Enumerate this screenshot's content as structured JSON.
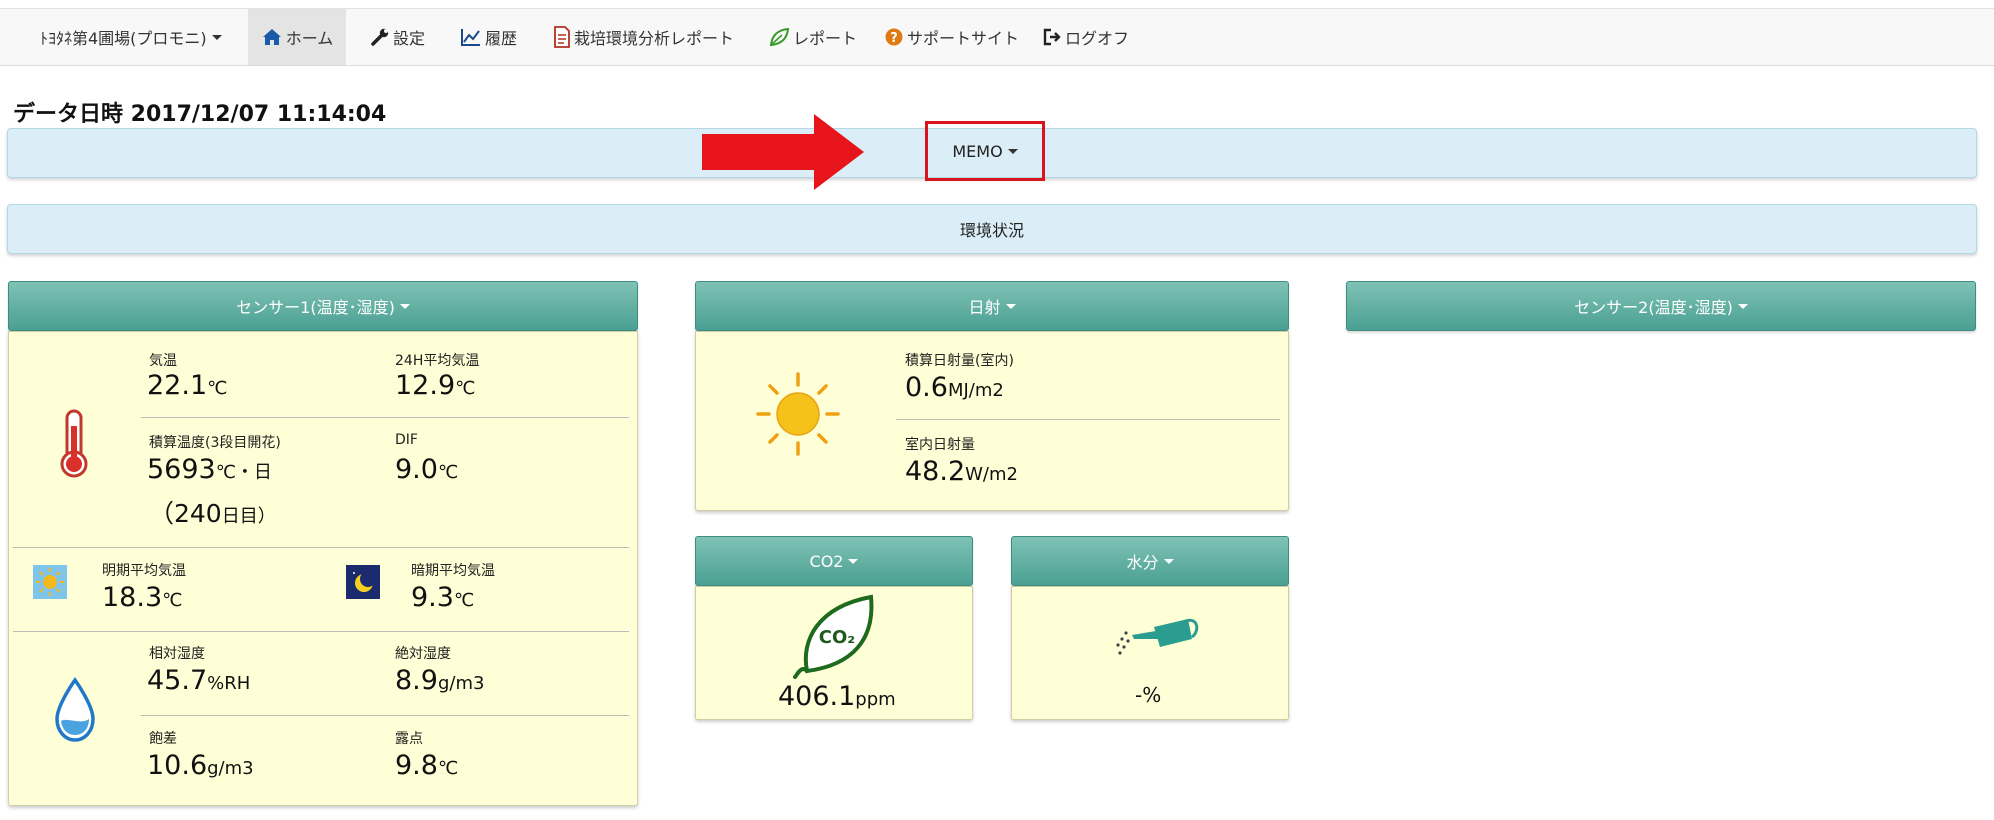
{
  "nav": {
    "farm": "ﾄﾖﾀﾈ第4圃場(プロモニ)",
    "home": "ホーム",
    "settings": "設定",
    "history": "履歴",
    "analysis_report": "栽培環境分析レポート",
    "report": "レポート",
    "support": "サポートサイト",
    "logoff": "ログオフ"
  },
  "data_time": "データ日時 2017/12/07 11:14:04",
  "memo_label": "MEMO",
  "env_status_label": "環境状況",
  "sensor1": {
    "title": "センサー1(温度･湿度)",
    "temp_label": "気温",
    "temp_value": "22.1",
    "temp_unit": "℃",
    "avg24_label": "24H平均気温",
    "avg24_value": "12.9",
    "avg24_unit": "℃",
    "accum_label": "積算温度(3段目開花)",
    "accum_value": "5693",
    "accum_unit": "℃・日",
    "days_value": "（240",
    "days_unit": "日目）",
    "dif_label": "DIF",
    "dif_value": "9.0",
    "dif_unit": "℃",
    "light_label": "明期平均気温",
    "light_value": "18.3",
    "light_unit": "℃",
    "dark_label": "暗期平均気温",
    "dark_value": "9.3",
    "dark_unit": "℃",
    "rh_label": "相対湿度",
    "rh_value": "45.7",
    "rh_unit": "%RH",
    "ah_label": "絶対湿度",
    "ah_value": "8.9",
    "ah_unit": "g/m3",
    "def_label": "飽差",
    "def_value": "10.6",
    "def_unit": "g/m3",
    "dew_label": "露点",
    "dew_value": "9.8",
    "dew_unit": "℃"
  },
  "solar": {
    "title": "日射",
    "accum_label": "積算日射量(室内)",
    "accum_value": "0.6",
    "accum_unit": "MJ/m2",
    "inside_label": "室内日射量",
    "inside_value": "48.2",
    "inside_unit": "W/m2"
  },
  "sensor2": {
    "title": "センサー2(温度･湿度)"
  },
  "co2": {
    "title": "CO2",
    "icon_text": "CO₂",
    "value": "406.1",
    "unit": "ppm"
  },
  "moisture": {
    "title": "水分",
    "value": "-%"
  },
  "colors": {
    "header": "#5aac9f",
    "panel_bg": "#ffffd7",
    "bar_bg": "#dbeef7",
    "highlight": "#d9141b",
    "accent_blue": "#1a5aa8"
  }
}
